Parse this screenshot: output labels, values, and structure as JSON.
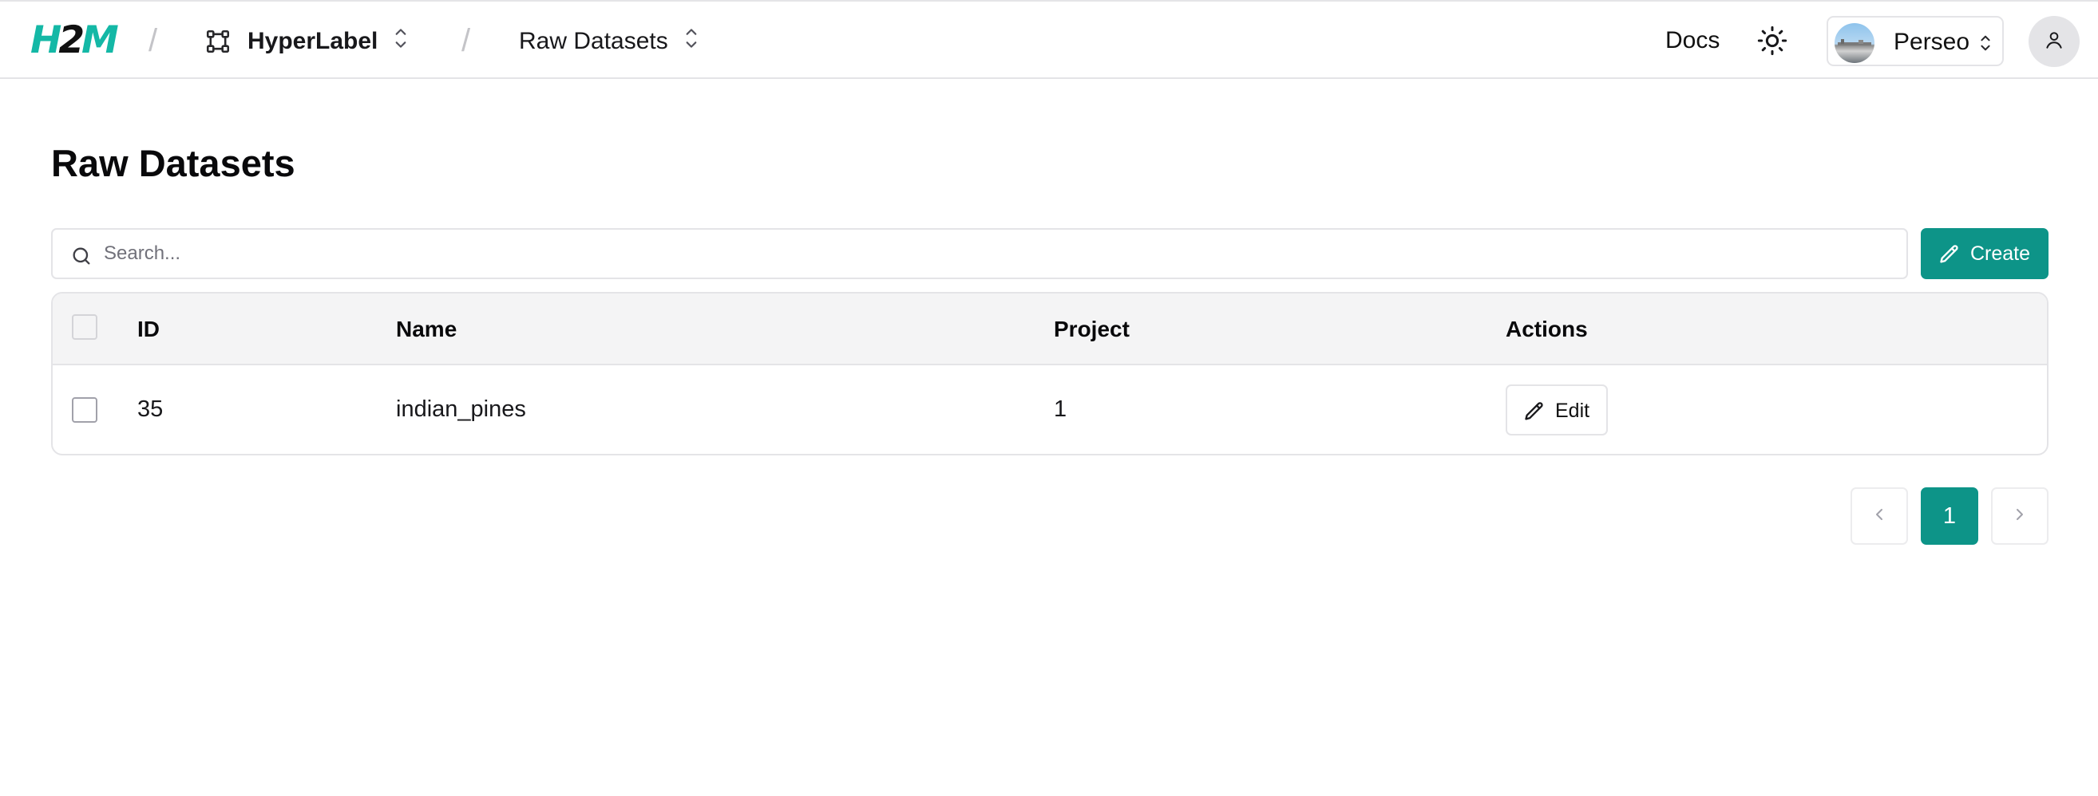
{
  "header": {
    "logo_text": "H2M",
    "project": {
      "label": "HyperLabel",
      "icon": "project-nodes-icon"
    },
    "section": {
      "label": "Raw Datasets"
    },
    "docs_label": "Docs",
    "theme_icon": "sun-icon",
    "team": {
      "name": "Perseo"
    },
    "user_icon": "user-icon"
  },
  "page": {
    "title": "Raw Datasets"
  },
  "search": {
    "placeholder": "Search...",
    "value": ""
  },
  "create_button": {
    "label": "Create"
  },
  "table": {
    "columns": [
      "ID",
      "Name",
      "Project",
      "Actions"
    ],
    "rows": [
      {
        "id": "35",
        "name": "indian_pines",
        "project": "1",
        "action_label": "Edit"
      }
    ]
  },
  "pagination": {
    "current_page": "1"
  },
  "colors": {
    "accent": "#0d9488",
    "logo_teal": "#14b8a6"
  }
}
